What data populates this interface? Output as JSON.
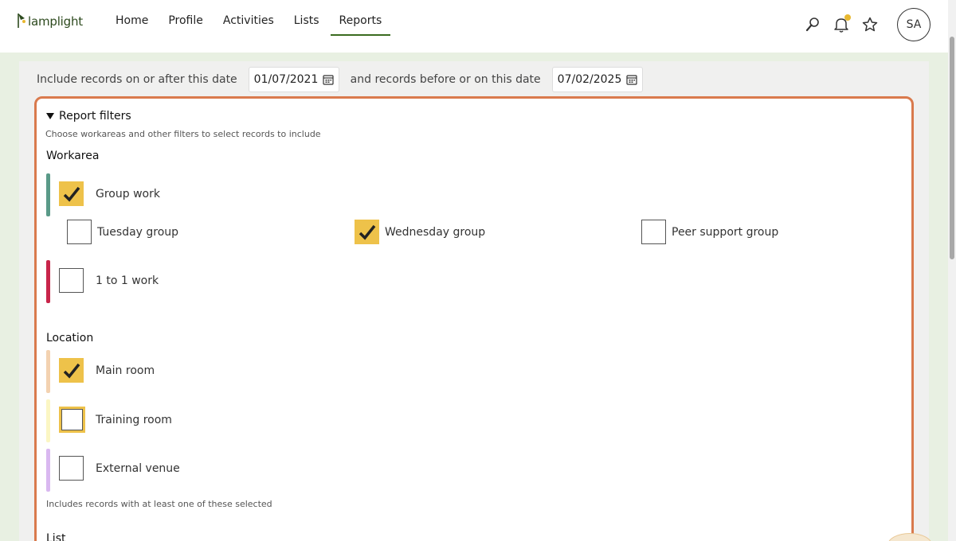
{
  "brand": {
    "name": "lamplight"
  },
  "nav": {
    "items": [
      {
        "label": "Home",
        "active": false
      },
      {
        "label": "Profile",
        "active": false
      },
      {
        "label": "Activities",
        "active": false
      },
      {
        "label": "Lists",
        "active": false
      },
      {
        "label": "Reports",
        "active": true
      }
    ]
  },
  "header": {
    "icons": [
      "search-icon",
      "bell-icon",
      "star-icon"
    ],
    "avatar_initials": "SA"
  },
  "dates": {
    "from_label": "Include records on or after this date",
    "from_value": "01/07/2021",
    "to_label": "and records before or on this date",
    "to_value": "07/02/2025"
  },
  "filters": {
    "toggle_label": "Report filters",
    "hint": "Choose workareas and other filters to select records to include",
    "workarea": {
      "title": "Workarea",
      "group_work": {
        "label": "Group work",
        "checked": true
      },
      "sub_groups": [
        {
          "label": "Tuesday group",
          "checked": false
        },
        {
          "label": "Wednesday group",
          "checked": true
        },
        {
          "label": "Peer support group",
          "checked": false
        }
      ],
      "one_to_one": {
        "label": "1 to 1 work",
        "checked": false
      }
    },
    "location": {
      "title": "Location",
      "options": [
        {
          "label": "Main room",
          "checked": true
        },
        {
          "label": "Training room",
          "checked": false
        },
        {
          "label": "External venue",
          "checked": false
        }
      ],
      "footnote": "Includes records with at least one of these selected"
    },
    "list": {
      "title": "List"
    }
  },
  "colors": {
    "accent": "#3a6b1f",
    "filters_border": "#d97a4d",
    "checkbox_checked": "#eec24a",
    "bar_group_work": "#5a9a88",
    "bar_one_to_one": "#c8254a",
    "bar_main_room": "#f3d2b1",
    "bar_training_room": "#fbf6c4",
    "bar_external_venue": "#d9b8f0"
  }
}
